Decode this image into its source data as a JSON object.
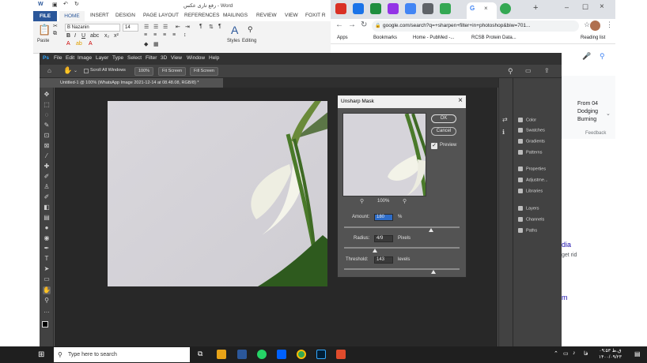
{
  "word": {
    "title": "رفع تاری عکس - Word",
    "tabs": [
      "FILE",
      "HOME",
      "INSERT",
      "DESIGN",
      "PAGE LAYOUT",
      "REFERENCES",
      "MAILINGS",
      "REVIEW",
      "VIEW",
      "FOXIT R"
    ],
    "font_name": "B Nazanin",
    "font_size": "14",
    "paste_label": "Paste",
    "styles_label": "Styles",
    "editing_label": "Editing"
  },
  "chrome": {
    "address": "google.com/search?q=+sharpen+filter+in+photoshop&biw=701...",
    "bookmarks": [
      "Apps",
      "Bookmarks",
      "Home - PubMed -...",
      "RCSB Protein Data..."
    ],
    "reading_list": "Reading list",
    "side_snippets": {
      "from": "From 04",
      "dodging": "Dodging",
      "burning": "Burning",
      "feedback": "Feedback",
      "dia": "dia",
      "get_rid": "get rid",
      "m": "m"
    }
  },
  "photoshop": {
    "menu": [
      "Ps",
      "File",
      "Edit",
      "Image",
      "Layer",
      "Type",
      "Select",
      "Filter",
      "3D",
      "View",
      "Window",
      "Help"
    ],
    "options": {
      "scroll_all": "Scroll All Windows",
      "zoom": "100%",
      "fit_screen": "Fit Screen",
      "fill_screen": "Fill Screen"
    },
    "doc_tab": "Untitled-1 @ 100% (WhatsApp Image 2021-12-14 at 08.48.08, RGB/8) *",
    "panels": [
      "Color",
      "Swatches",
      "Gradients",
      "Patterns",
      "Properties",
      "Adjustme...",
      "Libraries",
      "Layers",
      "Channels",
      "Paths"
    ]
  },
  "dialog": {
    "title": "Unsharp Mask",
    "ok": "OK",
    "cancel": "Cancel",
    "preview_label": "Preview",
    "preview_checked": true,
    "zoom": "100%",
    "amount_label": "Amount:",
    "amount_value": "180",
    "amount_unit": "%",
    "radius_label": "Radius:",
    "radius_value": "4/9",
    "radius_unit": "Pixels",
    "threshold_label": "Threshold:",
    "threshold_value": "143",
    "threshold_unit": "levels"
  },
  "taskbar": {
    "search_placeholder": "Type here to search",
    "time": "۰۹:۵۳ ق.ظ",
    "date": "۱۴۰۰/۰۹/۲۳",
    "lang": "فا"
  },
  "colors": {
    "word_blue": "#2b579a",
    "ps_bg": "#535353",
    "ps_dark": "#323232",
    "taskbar": "#1f1f1f"
  }
}
